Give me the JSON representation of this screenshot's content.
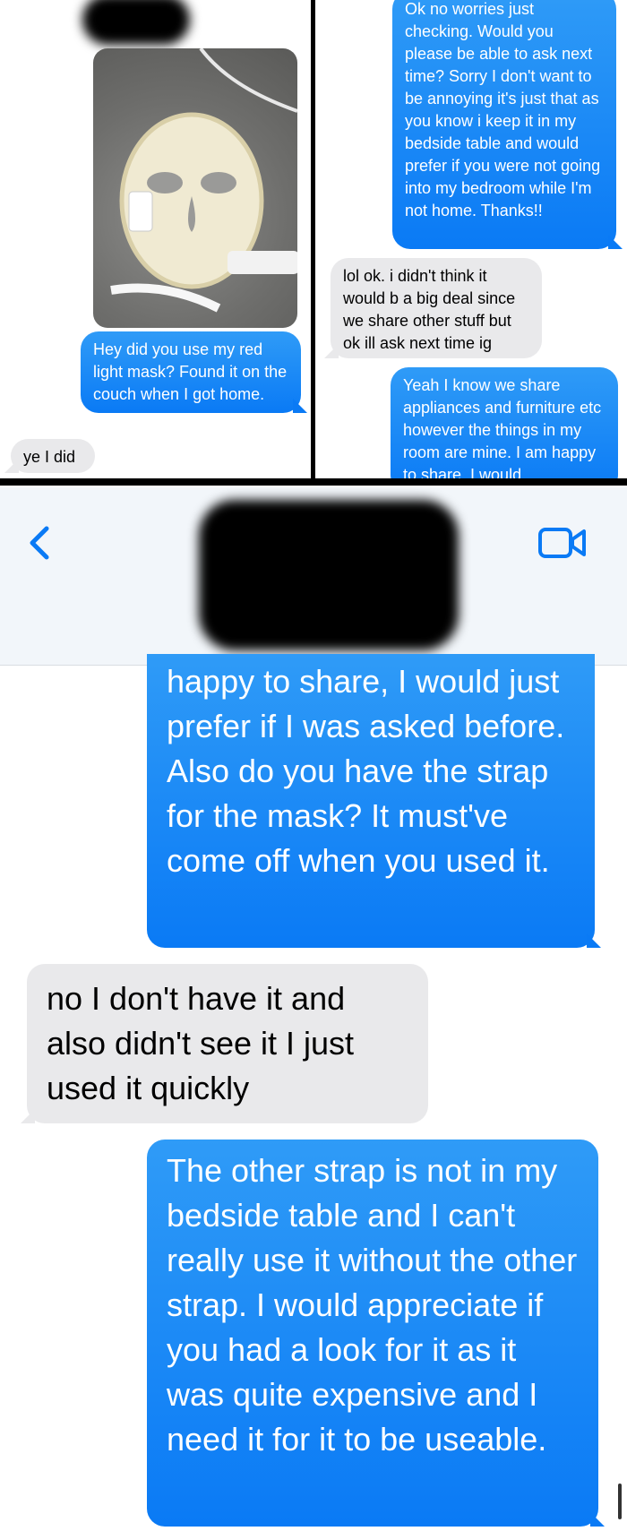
{
  "screenshot1": {
    "attachment": "photo",
    "messages": [
      {
        "from": "me",
        "text": "Hey did you use my red light mask? Found it on the couch when I got home."
      },
      {
        "from": "them",
        "text": "ye I did"
      }
    ]
  },
  "screenshot2": {
    "messages": [
      {
        "from": "me",
        "text": "Ok no worries just checking. Would you please be able to ask next time? Sorry I don't want to be annoying it's just that as you know i keep it in my bedside table and would prefer if you were not going into my bedroom while I'm not home. Thanks!!"
      },
      {
        "from": "them",
        "text": "lol ok. i didn't think it would b a big deal since we share other stuff but ok ill ask next time ig"
      },
      {
        "from": "me",
        "text": "Yeah I know we share appliances and furniture etc however the things in my room are mine. I am happy to share, I would"
      }
    ]
  },
  "screenshot3": {
    "header": {
      "back_icon": "chevron-left-icon",
      "video_icon": "video-camera-icon",
      "accent": "#0a7af5"
    },
    "messages": [
      {
        "from": "me",
        "text": "happy to share, I would just prefer if I was asked before. Also do you have the strap for the mask? It must've come off when you used it."
      },
      {
        "from": "them",
        "text": "no I don't have it and also didn't see it I just used it quickly"
      },
      {
        "from": "me",
        "text": "The other strap is not in my bedside table and I can't really use it without the other strap. I would appreciate if you had a look for it as it was quite expensive and I need it for it to be useable."
      }
    ]
  },
  "colors": {
    "sent": "#0a7af5",
    "received": "#e9e9eb",
    "header": "#f2f6fa"
  }
}
